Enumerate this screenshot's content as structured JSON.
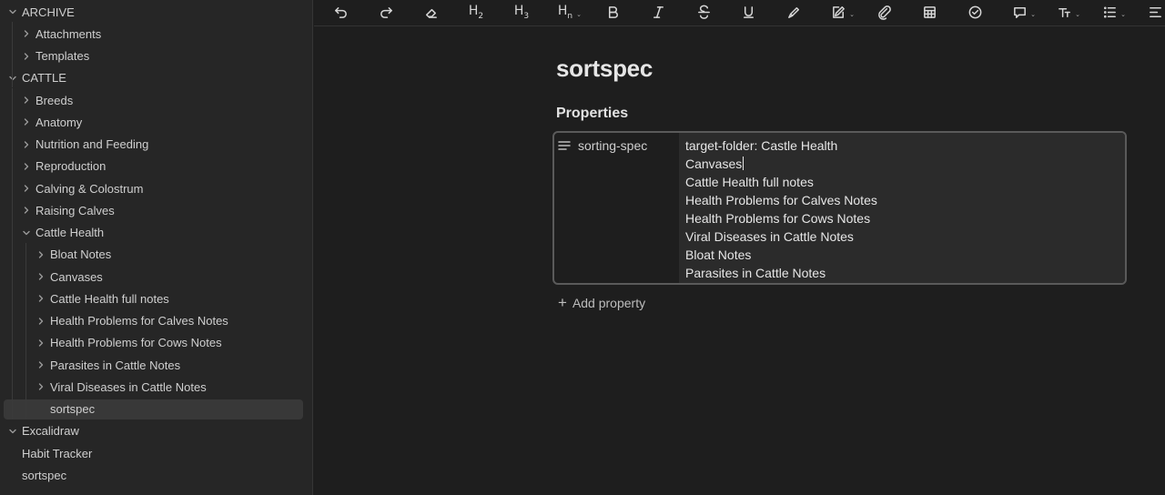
{
  "sidebar": {
    "items": [
      {
        "label": "ARCHIVE",
        "depth": 0,
        "chevron": "down"
      },
      {
        "label": "Attachments",
        "depth": 1,
        "chevron": "right"
      },
      {
        "label": "Templates",
        "depth": 1,
        "chevron": "right"
      },
      {
        "label": "CATTLE",
        "depth": 0,
        "chevron": "down"
      },
      {
        "label": "Breeds",
        "depth": 1,
        "chevron": "right"
      },
      {
        "label": "Anatomy",
        "depth": 1,
        "chevron": "right"
      },
      {
        "label": "Nutrition and Feeding",
        "depth": 1,
        "chevron": "right"
      },
      {
        "label": "Reproduction",
        "depth": 1,
        "chevron": "right"
      },
      {
        "label": "Calving & Colostrum",
        "depth": 1,
        "chevron": "right"
      },
      {
        "label": "Raising Calves",
        "depth": 1,
        "chevron": "right"
      },
      {
        "label": "Cattle Health",
        "depth": 1,
        "chevron": "down"
      },
      {
        "label": "Bloat Notes",
        "depth": 2,
        "chevron": "right"
      },
      {
        "label": "Canvases",
        "depth": 2,
        "chevron": "right"
      },
      {
        "label": "Cattle Health full notes",
        "depth": 2,
        "chevron": "right"
      },
      {
        "label": "Health Problems for Calves Notes",
        "depth": 2,
        "chevron": "right"
      },
      {
        "label": "Health Problems for Cows Notes",
        "depth": 2,
        "chevron": "right"
      },
      {
        "label": "Parasites in Cattle Notes",
        "depth": 2,
        "chevron": "right"
      },
      {
        "label": "Viral Diseases in Cattle Notes",
        "depth": 2,
        "chevron": "right"
      },
      {
        "label": "sortspec",
        "depth": 2,
        "chevron": "none",
        "selected": true
      },
      {
        "label": "Excalidraw",
        "depth": 0,
        "chevron": "down"
      },
      {
        "label": "Habit Tracker",
        "depth": 0,
        "chevron": "none"
      },
      {
        "label": "sortspec",
        "depth": 0,
        "chevron": "none"
      }
    ]
  },
  "toolbar": {
    "buttons": [
      {
        "name": "undo-icon",
        "text": ""
      },
      {
        "name": "redo-icon",
        "text": ""
      },
      {
        "name": "eraser-icon",
        "text": ""
      },
      {
        "name": "heading-2-icon",
        "text": "H2"
      },
      {
        "name": "heading-3-icon",
        "text": "H3"
      },
      {
        "name": "heading-n-icon",
        "text": "Hn"
      },
      {
        "name": "bold-icon",
        "text": ""
      },
      {
        "name": "italic-icon",
        "text": ""
      },
      {
        "name": "strikethrough-icon",
        "text": ""
      },
      {
        "name": "underline-icon",
        "text": ""
      },
      {
        "name": "highlighter-icon",
        "text": ""
      },
      {
        "name": "edit-icon",
        "text": ""
      },
      {
        "name": "attachment-icon",
        "text": ""
      },
      {
        "name": "table-icon",
        "text": ""
      },
      {
        "name": "checkbox-icon",
        "text": ""
      },
      {
        "name": "comment-icon",
        "text": ""
      },
      {
        "name": "text-format-icon",
        "text": ""
      },
      {
        "name": "list-icon",
        "text": ""
      },
      {
        "name": "align-icon",
        "text": ""
      }
    ]
  },
  "note": {
    "title": "sortspec",
    "properties_heading": "Properties",
    "property": {
      "key": "sorting-spec",
      "icon": "text-lines-icon",
      "lines": [
        "target-folder: Castle Health",
        "Canvases",
        "Cattle Health full notes",
        "Health Problems for Calves Notes",
        "Health Problems for Cows Notes",
        "Viral Diseases in Cattle Notes",
        "Bloat Notes",
        "Parasites in Cattle Notes"
      ]
    },
    "add_property_label": "Add property"
  }
}
